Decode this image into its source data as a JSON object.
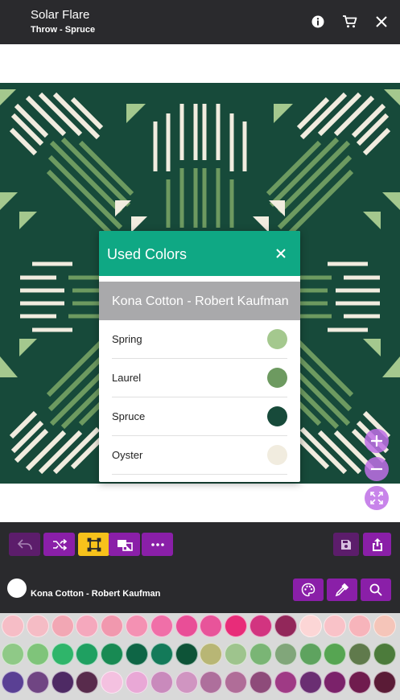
{
  "header": {
    "title": "Solar Flare",
    "subtitle": "Throw - Spruce",
    "icons": [
      "info-icon",
      "cart-icon",
      "close-icon"
    ]
  },
  "modal": {
    "title": "Used Colors",
    "brand": "Kona Cotton - Robert Kaufman",
    "colors": [
      {
        "name": "Spring",
        "hex": "#a4c88e"
      },
      {
        "name": "Laurel",
        "hex": "#6d9a60"
      },
      {
        "name": "Spruce",
        "hex": "#174a3a"
      },
      {
        "name": "Oyster",
        "hex": "#f1ecdf"
      }
    ]
  },
  "toolbar": {
    "left_buttons": [
      "undo-icon",
      "shuffle-icon",
      "select-icon",
      "swap-icon",
      "more-icon"
    ],
    "right_buttons": [
      "save-icon",
      "share-icon"
    ]
  },
  "brand_bar": {
    "name": "Kona Cotton - Robert Kaufman",
    "buttons": [
      "palette-icon",
      "eyedropper-icon",
      "search-icon"
    ]
  },
  "palette": [
    [
      "#f6bdc6",
      "#f5bcc5",
      "#f2a7b4",
      "#f5a8bd",
      "#f198ae",
      "#f491b3",
      "#f06fa8",
      "#e94e97",
      "#e8549a",
      "#e82c79",
      "#d23480",
      "#92275a",
      "#fcd6d6",
      "#f9c2c8",
      "#f7b4bb",
      "#f5c5b9"
    ],
    [
      "#8fc987",
      "#7fc47a",
      "#2fb56a",
      "#1fa061",
      "#188a53",
      "#0e6545",
      "#137a59",
      "#0d5337",
      "#b8b675",
      "#9ec48d",
      "#7ab575",
      "#81a67a",
      "#5ea35f",
      "#56a552",
      "#607a4c",
      "#4c7b3b"
    ],
    [
      "#5a4094",
      "#704583",
      "#4e2a64",
      "#582b4c",
      "#f4c1e0",
      "#e9a8d6",
      "#c98abc",
      "#d095c1",
      "#ae6f9c",
      "#b06d98",
      "#8e4b7a",
      "#9f3a85",
      "#6a2e72",
      "#7b226a",
      "#701c4e",
      "#5a1b36"
    ]
  ]
}
